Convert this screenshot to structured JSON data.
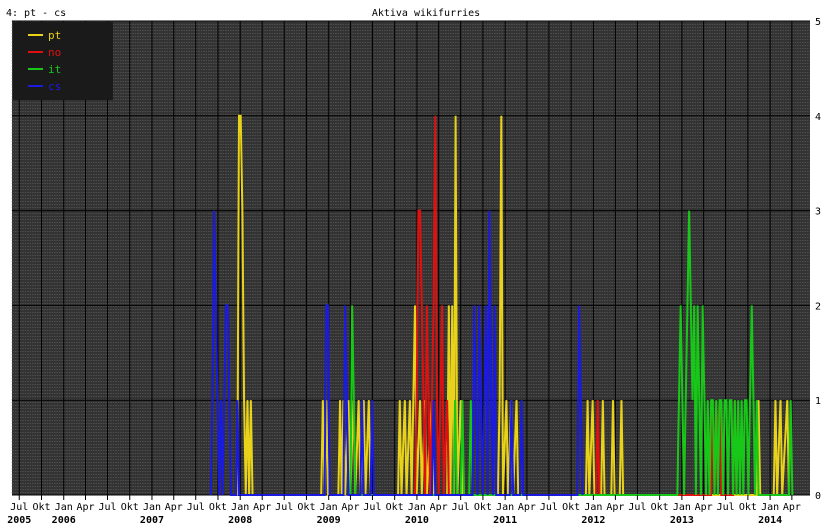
{
  "header": {
    "chart_id": "4: pt - cs"
  },
  "colors": {
    "background": "#ffffff",
    "plot_background": "#333333",
    "grid_major": "#000000",
    "grid_minor": "#6a6a6a",
    "legend_background": "#1a1a1a"
  },
  "chart_data": {
    "type": "line",
    "title": "Aktiva wikifurries",
    "xlabel": "",
    "ylabel": "",
    "ylim": [
      0,
      5
    ],
    "xlim": [
      "2005-06-01",
      "2014-06-15"
    ],
    "y_ticks": [
      0,
      1,
      2,
      3,
      4,
      5
    ],
    "grid": true,
    "legend": "top-left",
    "x_month_labels": [
      {
        "date": "2005-07-01",
        "label": "Jul"
      },
      {
        "date": "2005-10-01",
        "label": "Okt"
      },
      {
        "date": "2006-01-01",
        "label": "Jan"
      },
      {
        "date": "2006-04-01",
        "label": "Apr"
      },
      {
        "date": "2006-07-01",
        "label": "Jul"
      },
      {
        "date": "2006-10-01",
        "label": "Okt"
      },
      {
        "date": "2007-01-01",
        "label": "Jan"
      },
      {
        "date": "2007-04-01",
        "label": "Apr"
      },
      {
        "date": "2007-07-01",
        "label": "Jul"
      },
      {
        "date": "2007-10-01",
        "label": "Okt"
      },
      {
        "date": "2008-01-01",
        "label": "Jan"
      },
      {
        "date": "2008-04-01",
        "label": "Apr"
      },
      {
        "date": "2008-07-01",
        "label": "Jul"
      },
      {
        "date": "2008-10-01",
        "label": "Okt"
      },
      {
        "date": "2009-01-01",
        "label": "Jan"
      },
      {
        "date": "2009-04-01",
        "label": "Apr"
      },
      {
        "date": "2009-07-01",
        "label": "Jul"
      },
      {
        "date": "2009-10-01",
        "label": "Okt"
      },
      {
        "date": "2010-01-01",
        "label": "Jan"
      },
      {
        "date": "2010-04-01",
        "label": "Apr"
      },
      {
        "date": "2010-07-01",
        "label": "Jul"
      },
      {
        "date": "2010-10-01",
        "label": "Okt"
      },
      {
        "date": "2011-01-01",
        "label": "Jan"
      },
      {
        "date": "2011-04-01",
        "label": "Apr"
      },
      {
        "date": "2011-07-01",
        "label": "Jul"
      },
      {
        "date": "2011-10-01",
        "label": "Okt"
      },
      {
        "date": "2012-01-01",
        "label": "Jan"
      },
      {
        "date": "2012-04-01",
        "label": "Apr"
      },
      {
        "date": "2012-07-01",
        "label": "Jul"
      },
      {
        "date": "2012-10-01",
        "label": "Okt"
      },
      {
        "date": "2013-01-01",
        "label": "Jan"
      },
      {
        "date": "2013-04-01",
        "label": "Apr"
      },
      {
        "date": "2013-07-01",
        "label": "Jul"
      },
      {
        "date": "2013-10-01",
        "label": "Okt"
      },
      {
        "date": "2014-01-01",
        "label": "Jan"
      },
      {
        "date": "2014-04-01",
        "label": "Apr"
      }
    ],
    "x_year_labels": [
      {
        "date": "2005-07-01",
        "label": "2005"
      },
      {
        "date": "2006-01-01",
        "label": "2006"
      },
      {
        "date": "2007-01-01",
        "label": "2007"
      },
      {
        "date": "2008-01-01",
        "label": "2008"
      },
      {
        "date": "2009-01-01",
        "label": "2009"
      },
      {
        "date": "2010-01-01",
        "label": "2010"
      },
      {
        "date": "2011-01-01",
        "label": "2011"
      },
      {
        "date": "2012-01-01",
        "label": "2012"
      },
      {
        "date": "2013-01-01",
        "label": "2013"
      },
      {
        "date": "2014-01-01",
        "label": "2014"
      }
    ],
    "series": [
      {
        "name": "pt",
        "color": "#e8d21a",
        "points": [
          [
            "2007-12-20",
            0
          ],
          [
            "2007-12-27",
            4
          ],
          [
            "2008-01-03",
            4
          ],
          [
            "2008-01-10",
            3
          ],
          [
            "2008-01-17",
            1
          ],
          [
            "2008-01-24",
            0
          ],
          [
            "2008-01-31",
            1
          ],
          [
            "2008-02-07",
            0
          ],
          [
            "2008-02-14",
            1
          ],
          [
            "2008-02-21",
            0
          ],
          [
            "2008-02-28",
            0
          ],
          [
            "2008-12-01",
            0
          ],
          [
            "2008-12-08",
            1
          ],
          [
            "2008-12-15",
            0
          ],
          [
            "2008-12-22",
            1
          ],
          [
            "2008-12-29",
            0
          ],
          [
            "2009-02-10",
            0
          ],
          [
            "2009-02-17",
            1
          ],
          [
            "2009-02-24",
            0
          ],
          [
            "2009-03-03",
            1
          ],
          [
            "2009-03-10",
            0
          ],
          [
            "2009-03-24",
            1
          ],
          [
            "2009-03-31",
            0
          ],
          [
            "2009-04-14",
            1
          ],
          [
            "2009-04-21",
            0
          ],
          [
            "2009-05-05",
            1
          ],
          [
            "2009-05-12",
            0
          ],
          [
            "2009-05-26",
            1
          ],
          [
            "2009-06-02",
            0
          ],
          [
            "2009-06-16",
            1
          ],
          [
            "2009-06-23",
            0
          ],
          [
            "2009-10-15",
            0
          ],
          [
            "2009-10-22",
            1
          ],
          [
            "2009-10-29",
            0
          ],
          [
            "2009-11-12",
            1
          ],
          [
            "2009-11-19",
            0
          ],
          [
            "2009-12-03",
            1
          ],
          [
            "2009-12-10",
            0
          ],
          [
            "2009-12-24",
            2
          ],
          [
            "2009-12-31",
            0
          ],
          [
            "2010-01-14",
            1
          ],
          [
            "2010-01-21",
            0
          ],
          [
            "2010-02-04",
            1
          ],
          [
            "2010-02-11",
            0
          ],
          [
            "2010-03-04",
            1
          ],
          [
            "2010-03-11",
            0
          ],
          [
            "2010-05-06",
            0
          ],
          [
            "2010-05-13",
            2
          ],
          [
            "2010-05-20",
            0
          ],
          [
            "2010-05-27",
            2
          ],
          [
            "2010-06-03",
            0
          ],
          [
            "2010-06-10",
            4
          ],
          [
            "2010-06-17",
            0
          ],
          [
            "2010-07-01",
            1
          ],
          [
            "2010-07-08",
            0
          ],
          [
            "2010-12-02",
            0
          ],
          [
            "2010-12-09",
            1
          ],
          [
            "2010-12-16",
            4
          ],
          [
            "2010-12-23",
            0
          ],
          [
            "2011-01-06",
            1
          ],
          [
            "2011-01-13",
            0
          ],
          [
            "2011-01-27",
            1
          ],
          [
            "2011-02-03",
            0
          ],
          [
            "2011-02-17",
            1
          ],
          [
            "2011-02-24",
            0
          ],
          [
            "2011-12-01",
            0
          ],
          [
            "2011-12-08",
            1
          ],
          [
            "2011-12-15",
            0
          ],
          [
            "2011-12-29",
            1
          ],
          [
            "2012-01-05",
            0
          ],
          [
            "2012-02-02",
            0
          ],
          [
            "2012-02-09",
            1
          ],
          [
            "2012-02-16",
            0
          ],
          [
            "2012-03-15",
            0
          ],
          [
            "2012-03-22",
            1
          ],
          [
            "2012-03-29",
            0
          ],
          [
            "2012-04-19",
            0
          ],
          [
            "2012-04-26",
            1
          ],
          [
            "2012-05-03",
            0
          ],
          [
            "2013-11-07",
            0
          ],
          [
            "2013-11-14",
            1
          ],
          [
            "2013-11-21",
            0
          ],
          [
            "2014-01-16",
            0
          ],
          [
            "2014-01-23",
            1
          ],
          [
            "2014-01-30",
            0
          ],
          [
            "2014-02-13",
            1
          ],
          [
            "2014-02-20",
            0
          ],
          [
            "2014-03-13",
            1
          ],
          [
            "2014-03-20",
            0
          ]
        ]
      },
      {
        "name": "no",
        "color": "#e01010",
        "points": [
          [
            "2009-12-24",
            0
          ],
          [
            "2009-12-31",
            1
          ],
          [
            "2010-01-07",
            3
          ],
          [
            "2010-01-14",
            3
          ],
          [
            "2010-01-21",
            2
          ],
          [
            "2010-01-28",
            1
          ],
          [
            "2010-02-04",
            0
          ],
          [
            "2010-02-11",
            2
          ],
          [
            "2010-02-18",
            1
          ],
          [
            "2010-02-25",
            0
          ],
          [
            "2010-03-11",
            2
          ],
          [
            "2010-03-18",
            4
          ],
          [
            "2010-03-25",
            1
          ],
          [
            "2010-04-01",
            0
          ],
          [
            "2010-04-15",
            2
          ],
          [
            "2010-04-22",
            0
          ],
          [
            "2010-05-06",
            1
          ],
          [
            "2010-05-13",
            0
          ],
          [
            "2012-01-12",
            0
          ],
          [
            "2012-01-19",
            1
          ],
          [
            "2012-01-26",
            0
          ],
          [
            "2013-05-02",
            0
          ],
          [
            "2013-05-09",
            1
          ],
          [
            "2013-05-16",
            0
          ],
          [
            "2013-06-06",
            1
          ],
          [
            "2013-06-13",
            0
          ],
          [
            "2013-08-01",
            0
          ],
          [
            "2013-08-08",
            1
          ],
          [
            "2013-08-15",
            0
          ]
        ]
      },
      {
        "name": "it",
        "color": "#18c818",
        "points": [
          [
            "2009-04-01",
            0
          ],
          [
            "2009-04-08",
            2
          ],
          [
            "2009-04-15",
            1
          ],
          [
            "2009-04-22",
            0
          ],
          [
            "2010-06-01",
            0
          ],
          [
            "2010-06-08",
            1
          ],
          [
            "2010-06-15",
            0
          ],
          [
            "2010-07-01",
            0
          ],
          [
            "2010-07-08",
            1
          ],
          [
            "2010-07-15",
            0
          ],
          [
            "2010-08-05",
            0
          ],
          [
            "2010-08-12",
            1
          ],
          [
            "2010-08-19",
            0
          ],
          [
            "2012-12-13",
            0
          ],
          [
            "2012-12-20",
            1
          ],
          [
            "2012-12-27",
            2
          ],
          [
            "2013-01-03",
            1
          ],
          [
            "2013-01-10",
            0
          ],
          [
            "2013-01-17",
            1
          ],
          [
            "2013-01-24",
            2
          ],
          [
            "2013-01-31",
            3
          ],
          [
            "2013-02-07",
            2
          ],
          [
            "2013-02-14",
            1
          ],
          [
            "2013-02-21",
            2
          ],
          [
            "2013-02-28",
            0
          ],
          [
            "2013-03-07",
            2
          ],
          [
            "2013-03-14",
            1
          ],
          [
            "2013-03-21",
            0
          ],
          [
            "2013-03-28",
            2
          ],
          [
            "2013-04-04",
            1
          ],
          [
            "2013-04-11",
            0
          ],
          [
            "2013-04-18",
            1
          ],
          [
            "2013-04-25",
            0
          ],
          [
            "2013-05-02",
            1
          ],
          [
            "2013-05-09",
            1
          ],
          [
            "2013-05-16",
            0
          ],
          [
            "2013-05-23",
            1
          ],
          [
            "2013-05-30",
            0
          ],
          [
            "2013-06-06",
            1
          ],
          [
            "2013-06-13",
            1
          ],
          [
            "2013-06-20",
            0
          ],
          [
            "2013-06-27",
            1
          ],
          [
            "2013-07-04",
            1
          ],
          [
            "2013-07-11",
            0
          ],
          [
            "2013-07-18",
            1
          ],
          [
            "2013-07-25",
            1
          ],
          [
            "2013-08-01",
            0
          ],
          [
            "2013-08-08",
            1
          ],
          [
            "2013-08-15",
            0
          ],
          [
            "2013-08-22",
            1
          ],
          [
            "2013-08-29",
            0
          ],
          [
            "2013-09-05",
            1
          ],
          [
            "2013-09-12",
            0
          ],
          [
            "2013-09-19",
            1
          ],
          [
            "2013-09-26",
            1
          ],
          [
            "2013-10-03",
            0
          ],
          [
            "2013-10-10",
            1
          ],
          [
            "2013-10-17",
            2
          ],
          [
            "2013-10-24",
            1
          ],
          [
            "2013-10-31",
            0
          ],
          [
            "2013-11-07",
            1
          ],
          [
            "2013-11-14",
            0
          ],
          [
            "2014-03-20",
            0
          ],
          [
            "2014-03-27",
            1
          ],
          [
            "2014-04-03",
            0
          ]
        ]
      },
      {
        "name": "cs",
        "color": "#1a1ae0",
        "points": [
          [
            "2007-09-01",
            0
          ],
          [
            "2007-09-08",
            1
          ],
          [
            "2007-09-15",
            3
          ],
          [
            "2007-09-22",
            2
          ],
          [
            "2007-09-29",
            1
          ],
          [
            "2007-10-06",
            0
          ],
          [
            "2007-10-13",
            1
          ],
          [
            "2007-10-20",
            0
          ],
          [
            "2007-10-27",
            1
          ],
          [
            "2007-11-03",
            2
          ],
          [
            "2007-11-10",
            2
          ],
          [
            "2007-11-17",
            1
          ],
          [
            "2007-11-24",
            0
          ],
          [
            "2007-12-15",
            0
          ],
          [
            "2007-12-20",
            1
          ],
          [
            "2007-12-27",
            0
          ],
          [
            "2008-12-15",
            0
          ],
          [
            "2008-12-22",
            2
          ],
          [
            "2008-12-29",
            2
          ],
          [
            "2009-01-05",
            0
          ],
          [
            "2009-03-03",
            0
          ],
          [
            "2009-03-10",
            2
          ],
          [
            "2009-03-17",
            1
          ],
          [
            "2009-03-24",
            0
          ],
          [
            "2009-05-12",
            0
          ],
          [
            "2009-05-19",
            1
          ],
          [
            "2009-05-26",
            0
          ],
          [
            "2009-06-23",
            0
          ],
          [
            "2009-06-30",
            1
          ],
          [
            "2009-07-07",
            0
          ],
          [
            "2010-03-04",
            0
          ],
          [
            "2010-03-11",
            1
          ],
          [
            "2010-03-18",
            0
          ],
          [
            "2010-08-19",
            0
          ],
          [
            "2010-08-26",
            2
          ],
          [
            "2010-09-02",
            1
          ],
          [
            "2010-09-09",
            0
          ],
          [
            "2010-09-16",
            2
          ],
          [
            "2010-09-23",
            1
          ],
          [
            "2010-09-30",
            0
          ],
          [
            "2010-10-07",
            1
          ],
          [
            "2010-10-14",
            2
          ],
          [
            "2010-10-21",
            0
          ],
          [
            "2010-10-28",
            3
          ],
          [
            "2010-11-04",
            1
          ],
          [
            "2010-11-11",
            0
          ],
          [
            "2010-11-18",
            2
          ],
          [
            "2010-11-25",
            0
          ],
          [
            "2011-01-20",
            0
          ],
          [
            "2011-01-27",
            1
          ],
          [
            "2011-02-03",
            0
          ],
          [
            "2011-03-03",
            0
          ],
          [
            "2011-03-10",
            1
          ],
          [
            "2011-03-17",
            0
          ],
          [
            "2011-10-27",
            0
          ],
          [
            "2011-11-03",
            2
          ],
          [
            "2011-11-10",
            1
          ],
          [
            "2011-11-17",
            0
          ]
        ]
      }
    ]
  }
}
